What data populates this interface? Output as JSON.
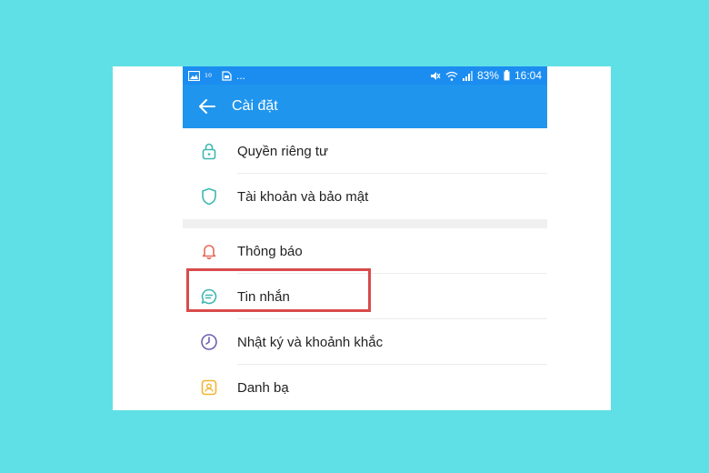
{
  "status_bar": {
    "left_icons": [
      "image-icon",
      "signal-icon",
      "sim-icon"
    ],
    "left_more": "...",
    "battery": "83%",
    "time": "16:04",
    "right_icons": [
      "mute-icon",
      "wifi-icon",
      "cell-signal-icon",
      "battery-icon"
    ]
  },
  "app_bar": {
    "title": "Cài đặt",
    "back_icon": "arrow-left-icon"
  },
  "settings_groups": [
    {
      "items": [
        {
          "label": "Quyền riêng tư",
          "icon": "lock-icon"
        },
        {
          "label": "Tài khoản và bảo mật",
          "icon": "shield-icon"
        }
      ]
    },
    {
      "items": [
        {
          "label": "Thông báo",
          "icon": "bell-icon"
        },
        {
          "label": "Tin nhắn",
          "icon": "message-icon",
          "highlighted": true
        },
        {
          "label": "Nhật ký và khoảnh khắc",
          "icon": "clock-icon"
        },
        {
          "label": "Danh bạ",
          "icon": "contacts-icon"
        }
      ]
    }
  ],
  "colors": {
    "background": "#5fe0e6",
    "app_bar": "#1f95ee",
    "status_bar": "#1c8df0",
    "highlight_border": "#d94b4b",
    "icon_teal": "#3fb8b0",
    "icon_red": "#e86a5c",
    "icon_purple": "#6d5fb0",
    "icon_yellow": "#f2b535"
  }
}
